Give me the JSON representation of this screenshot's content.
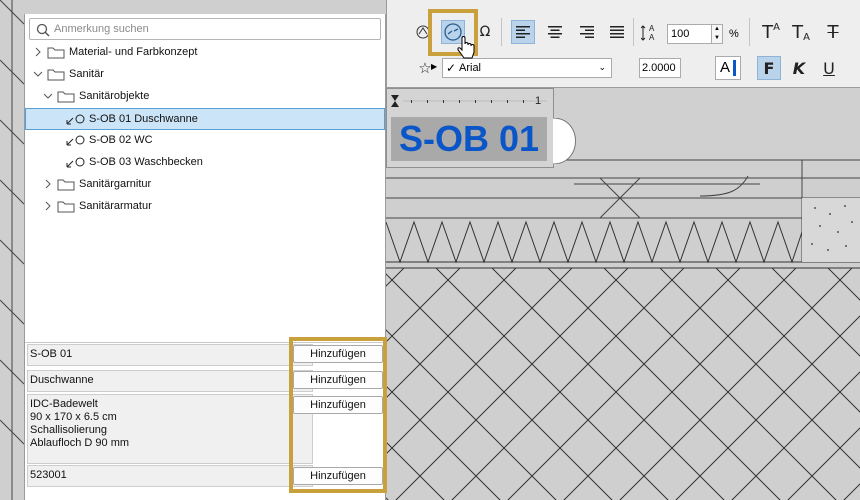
{
  "search": {
    "placeholder": "Anmerkung suchen"
  },
  "tree": [
    {
      "label": "Material- und Farbkonzept",
      "type": "folder",
      "expanded": false
    },
    {
      "label": "Sanitär",
      "type": "folder",
      "expanded": true
    },
    {
      "label": "Sanitärobjekte",
      "type": "folder",
      "expanded": true
    },
    {
      "label": "S-OB 01 Duschwanne",
      "type": "annotation",
      "selected": true
    },
    {
      "label": "S-OB 02 WC",
      "type": "annotation"
    },
    {
      "label": "S-OB 03 Waschbecken",
      "type": "annotation"
    },
    {
      "label": "Sanitärgarnitur",
      "type": "folder",
      "expanded": false
    },
    {
      "label": "Sanitärarmatur",
      "type": "folder",
      "expanded": false
    }
  ],
  "fields": [
    {
      "value": "S-OB 01",
      "button": "Hinzufügen"
    },
    {
      "value": "Duschwanne",
      "button": "Hinzufügen"
    },
    {
      "value": "IDC-Badewelt\n90 x 170 x 6.5 cm\nSchallisolierung\nAblaufloch D 90 mm",
      "button": "Hinzufügen"
    },
    {
      "value": "523001",
      "button": "Hinzufügen"
    }
  ],
  "toolbar": {
    "percent_value": "100",
    "percent_unit": "%",
    "font_name": "Arial",
    "text_size": "2.0000",
    "bold_label": "F",
    "italic_label": "K",
    "underline_label": "U",
    "color_label": "A",
    "superscript_label": "T",
    "subscript_label": "T",
    "strikethrough_label": "T"
  },
  "label_preview": {
    "text": "S-OB 01",
    "ruler_number": "1"
  },
  "colors": {
    "highlight": "#c8a03c",
    "selection": "#cce4f7",
    "label_text": "#0a55c8"
  }
}
